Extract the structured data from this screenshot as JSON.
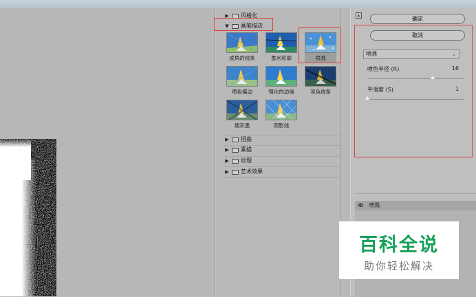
{
  "folders": {
    "stylize": "风格化",
    "brush_strokes": "画笔描边",
    "distort": "扭曲",
    "sketch": "素描",
    "texture": "纹理",
    "artistic": "艺术效果"
  },
  "thumbnails": [
    {
      "label": "成角的线条"
    },
    {
      "label": "墨水轮廓"
    },
    {
      "label": "喷溅"
    },
    {
      "label": "喷色描边"
    },
    {
      "label": "强化的边缘"
    },
    {
      "label": "深色线条"
    },
    {
      "label": "烟灰墨"
    },
    {
      "label": "阴影线"
    }
  ],
  "buttons": {
    "ok": "确定",
    "cancel": "取消"
  },
  "filter_select": {
    "value": "喷溅"
  },
  "params": {
    "spray_radius": {
      "label": "喷色半径 (R)",
      "value": "16",
      "level": 0.68
    },
    "smoothness": {
      "label": "平滑度 (S)",
      "value": "1",
      "level": 0.0
    }
  },
  "layer": {
    "name": "喷溅"
  },
  "watermark": {
    "title": "百科全说",
    "subtitle": "助你轻松解决"
  },
  "colors": {
    "highlight_border": "#e0413b",
    "watermark_green": "#18a05a"
  }
}
